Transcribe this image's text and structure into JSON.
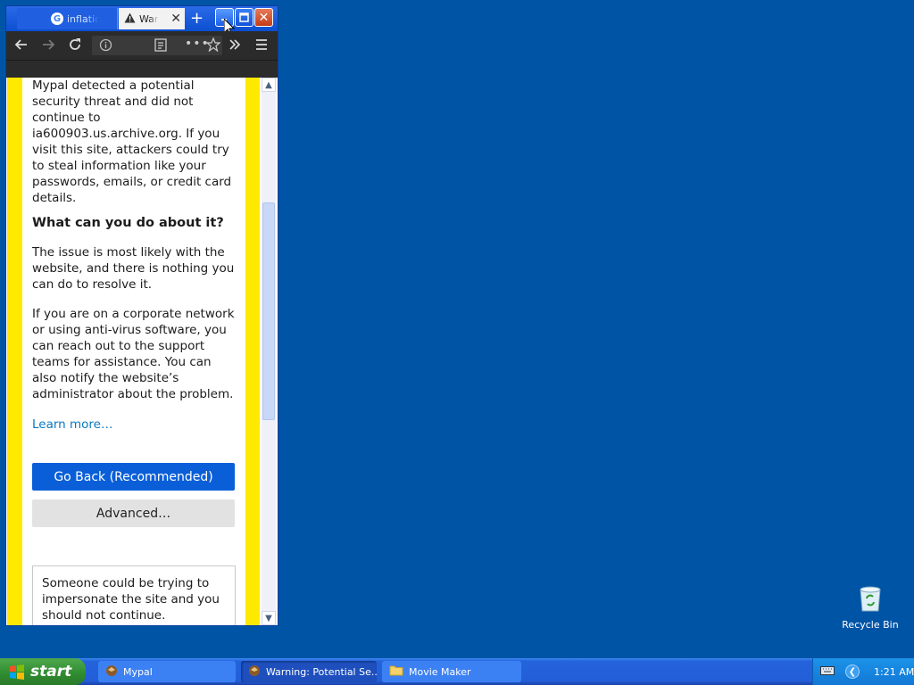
{
  "browser": {
    "tabs": [
      {
        "title": "inflation",
        "active": false
      },
      {
        "title": "Warning: Potential Security Risk Ahead",
        "active": true
      }
    ],
    "new_tab_symbol": "+",
    "controls": {
      "minimize": "minimize-icon",
      "maximize": "maximize-icon",
      "close": "close-icon"
    },
    "toolbar_icons": [
      "back-arrow-icon",
      "forward-arrow-icon",
      "reload-icon",
      "info-icon",
      "reader-view-icon",
      "more-icon",
      "bookmark-star-icon",
      "overflow-chevron-icon",
      "hamburger-menu-icon"
    ]
  },
  "page": {
    "intro": "Mypal detected a potential security threat and did not continue to ia600903.us.archive.org. If you visit this site, attackers could try to steal information like your passwords, emails, or credit card details.",
    "what_heading": "What can you do about it?",
    "issue_text": "The issue is most likely with the website, and there is nothing you can do to resolve it.",
    "corporate_text": "If you are on a corporate network or using anti-virus software, you can reach out to the support teams for assistance. You can also notify the website’s administrator about the problem.",
    "learn_more": "Learn more…",
    "go_back_button": "Go Back (Recommended)",
    "advanced_button": "Advanced…",
    "details_text": "Someone could be trying to impersonate the site and you should not continue."
  },
  "desktop": {
    "recycle_bin_label": "Recycle Bin"
  },
  "taskbar": {
    "start_label": "start",
    "tasks": [
      {
        "label": "Mypal",
        "icon": "mypal-icon"
      },
      {
        "label": "Warning: Potential Se...",
        "icon": "mypal-icon"
      },
      {
        "label": "Movie Maker",
        "icon": "folder-icon"
      }
    ],
    "clock": "1:21 AM"
  },
  "colors": {
    "desktop": "#0054a6",
    "warning_stripe": "#ffe900",
    "primary_button": "#0a5fd8",
    "link": "#0a7ac0"
  }
}
